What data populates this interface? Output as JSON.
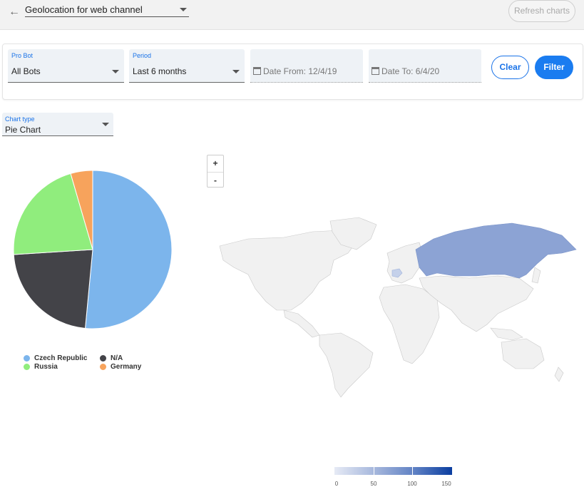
{
  "header": {
    "back_icon": "arrow-left-icon",
    "title": "Geolocation for web channel",
    "refresh_label": "Refresh charts"
  },
  "filters": {
    "bot": {
      "label": "Pro Bot",
      "value": "All Bots"
    },
    "period": {
      "label": "Period",
      "value": "Last 6 months"
    },
    "date_from": {
      "icon": "calendar-icon",
      "text": "Date From: 12/4/19"
    },
    "date_to": {
      "icon": "calendar-icon",
      "text": "Date To: 6/4/20"
    },
    "clear_label": "Clear",
    "filter_label": "Filter"
  },
  "chart_type": {
    "label": "Chart type",
    "value": "Pie Chart"
  },
  "colors": {
    "accent": "#1a7cf0"
  },
  "chart_data": {
    "type": "pie",
    "slices": [
      {
        "name": "Czech Republic",
        "value": 51.5,
        "color": "#7cb5ec"
      },
      {
        "name": "N/A",
        "value": 22.5,
        "color": "#434348"
      },
      {
        "name": "Russia",
        "value": 21.5,
        "color": "#90ed7d"
      },
      {
        "name": "Germany",
        "value": 4.5,
        "color": "#f7a35c"
      }
    ],
    "legend_position": "bottom"
  },
  "map": {
    "zoom_in": "+",
    "zoom_out": "-",
    "highlighted_countries": [
      "Russia",
      "Czech Republic"
    ],
    "highlight_color": "#8ca3d4",
    "color_scale": {
      "ticks": [
        "0",
        "50",
        "100",
        "150"
      ]
    }
  }
}
